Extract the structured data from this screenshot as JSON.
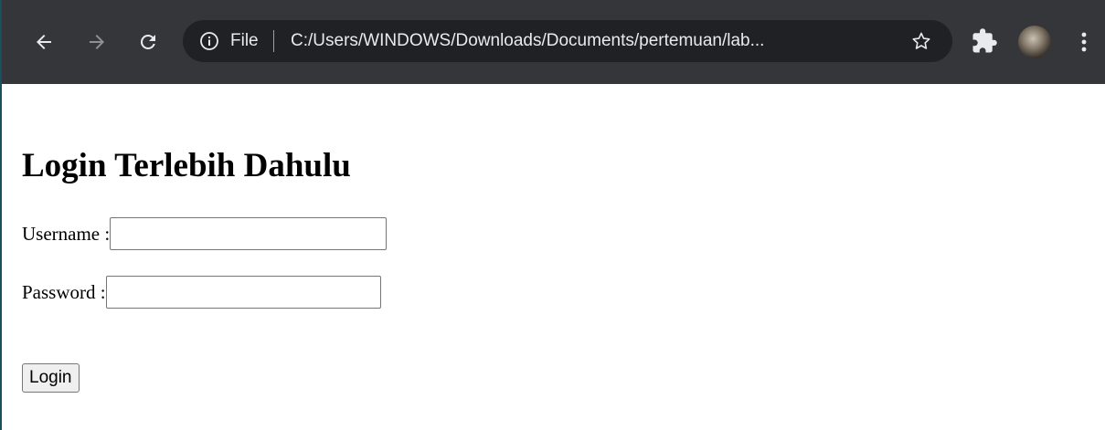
{
  "browser": {
    "omnibox": {
      "chip_label": "File",
      "url": "C:/Users/WINDOWS/Downloads/Documents/pertemuan/lab..."
    },
    "icons": {
      "back": "arrow-left-icon",
      "forward": "arrow-right-icon",
      "reload": "reload-icon",
      "info": "info-icon",
      "bookmark": "star-icon",
      "extensions": "puzzle-icon",
      "profile": "avatar",
      "menu": "vertical-dots-icon"
    },
    "colors": {
      "toolbar_bg": "#35363a",
      "omnibox_bg": "#202124",
      "text": "#e8eaed"
    }
  },
  "page": {
    "title": "Login Terlebih Dahulu",
    "form": {
      "username_label": "Username :",
      "username_value": "",
      "password_label": "Password :",
      "password_value": "",
      "submit_label": "Login"
    }
  }
}
